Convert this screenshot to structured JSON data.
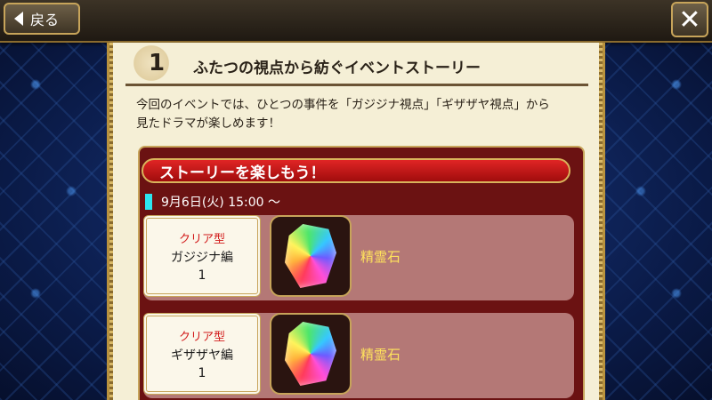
{
  "header": {
    "back_label": "戻る",
    "close_glyph": "✕"
  },
  "section": {
    "number": "1",
    "title": "ふたつの視点から紡ぐイベントストーリー",
    "description_line1": "今回のイベントでは、ひとつの事件を「ガジジナ視点」「ギザザヤ視点」から",
    "description_line2": "見たドラマが楽しめます！"
  },
  "story": {
    "banner": "ストーリーを楽しもう！",
    "date": "9月6日(火) 15:00 〜",
    "rewards": [
      {
        "kind": "クリア型",
        "name": "ガジジナ編",
        "count": "1",
        "icon": "rainbow-crystal-icon",
        "item": "精霊石"
      },
      {
        "kind": "クリア型",
        "name": "ギザザヤ編",
        "count": "1",
        "icon": "rainbow-crystal-icon",
        "item": "精霊石"
      }
    ]
  },
  "colors": {
    "banner_red": "#e02525",
    "date_marker": "#2ee6f0",
    "item_text": "#ffe35c",
    "kind_text": "#d21b1b"
  }
}
